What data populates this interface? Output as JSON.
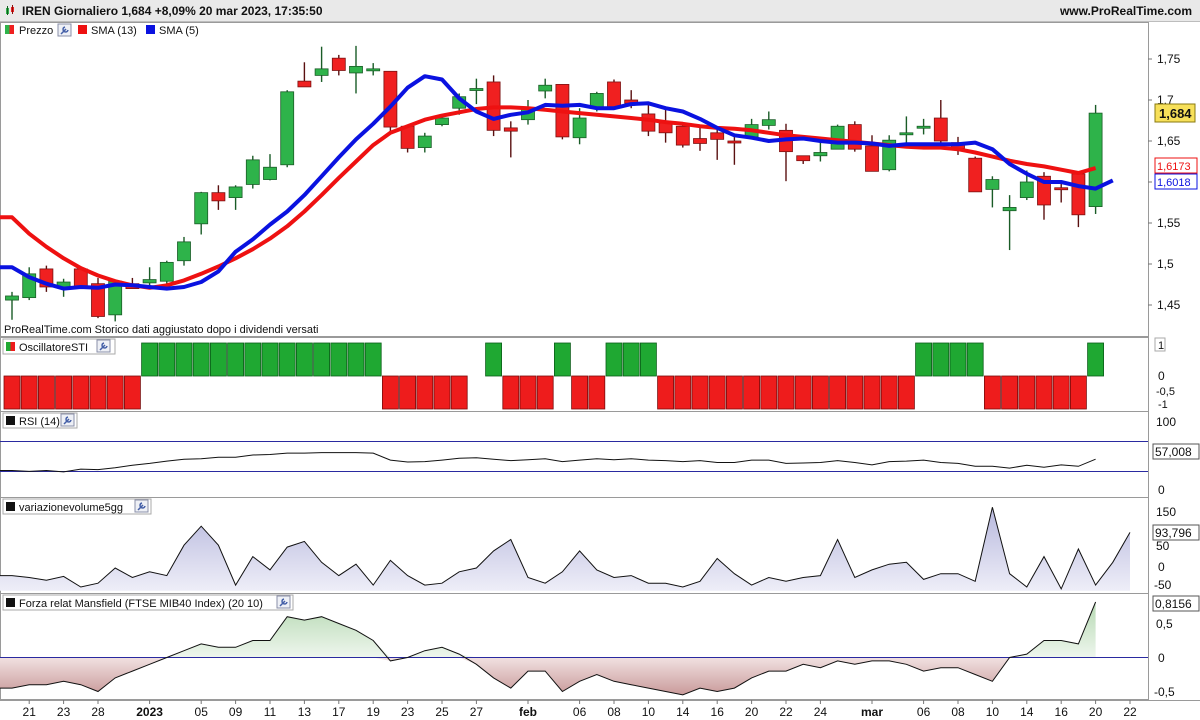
{
  "header": {
    "title": "IREN Giornaliero 1,684 +8,09% 20 mar 2023, 17:35:50",
    "site": "www.ProRealTime.com"
  },
  "colors": {
    "up": "#2eb34a",
    "down": "#f02020",
    "sma13": "#ee1111",
    "sma5": "#0a12e0",
    "osc_up": "#1fa832",
    "osc_down": "#ee1c1c"
  },
  "price_panel": {
    "legend": [
      "Prezzo",
      "SMA (13)",
      "SMA (5)"
    ],
    "footnote": "ProRealTime.com  Storico dati aggiustato dopo i dividendi versati",
    "ticks": [
      "1,75",
      "1,7",
      "1,65",
      "1,6",
      "1,55",
      "1,5",
      "1,45"
    ],
    "tick_values": [
      1.75,
      1.7,
      1.65,
      1.6,
      1.55,
      1.5,
      1.45
    ],
    "last_price": "1,684",
    "sma13_label": "1,6173",
    "sma5_label": "1,6018"
  },
  "osc_panel": {
    "title": "OscillatoreSTI",
    "ticks": [
      "1",
      "0",
      "-0,5",
      "-1"
    ]
  },
  "rsi_panel": {
    "title": "RSI (14)",
    "ticks": [
      "100",
      "0"
    ],
    "value_label": "57,008"
  },
  "vol_panel": {
    "title": "variazionevolume5gg",
    "ticks": [
      "150",
      "100",
      "50",
      "0",
      "-50"
    ],
    "value_label": "93,796"
  },
  "mans_panel": {
    "title": "Forza relat Mansfield (FTSE MIB40 Index) (20 10)",
    "ticks": [
      "0,5",
      "0",
      "-0,5"
    ],
    "value_label": "0,8156"
  },
  "x_labels": [
    {
      "i": 1,
      "t": "21"
    },
    {
      "i": 3,
      "t": "23"
    },
    {
      "i": 5,
      "t": "28"
    },
    {
      "i": 8,
      "t": "2023"
    },
    {
      "i": 11,
      "t": "05"
    },
    {
      "i": 13,
      "t": "09"
    },
    {
      "i": 15,
      "t": "11"
    },
    {
      "i": 17,
      "t": "13"
    },
    {
      "i": 19,
      "t": "17"
    },
    {
      "i": 21,
      "t": "19"
    },
    {
      "i": 23,
      "t": "23"
    },
    {
      "i": 25,
      "t": "25"
    },
    {
      "i": 27,
      "t": "27"
    },
    {
      "i": 30,
      "t": "feb"
    },
    {
      "i": 33,
      "t": "06"
    },
    {
      "i": 35,
      "t": "08"
    },
    {
      "i": 37,
      "t": "10"
    },
    {
      "i": 39,
      "t": "14"
    },
    {
      "i": 41,
      "t": "16"
    },
    {
      "i": 43,
      "t": "20"
    },
    {
      "i": 45,
      "t": "22"
    },
    {
      "i": 47,
      "t": "24"
    },
    {
      "i": 50,
      "t": "mar"
    },
    {
      "i": 53,
      "t": "06"
    },
    {
      "i": 55,
      "t": "08"
    },
    {
      "i": 57,
      "t": "10"
    },
    {
      "i": 59,
      "t": "14"
    },
    {
      "i": 61,
      "t": "16"
    },
    {
      "i": 63,
      "t": "20"
    },
    {
      "i": 65,
      "t": "22"
    }
  ],
  "chart_data": {
    "type": "candlestick",
    "candles": [
      {
        "o": 1.456,
        "h": 1.466,
        "l": 1.432,
        "c": 1.461
      },
      {
        "o": 1.459,
        "h": 1.496,
        "l": 1.456,
        "c": 1.488
      },
      {
        "o": 1.494,
        "h": 1.498,
        "l": 1.466,
        "c": 1.472
      },
      {
        "o": 1.472,
        "h": 1.482,
        "l": 1.46,
        "c": 1.478
      },
      {
        "o": 1.494,
        "h": 1.497,
        "l": 1.471,
        "c": 1.471
      },
      {
        "o": 1.476,
        "h": 1.483,
        "l": 1.434,
        "c": 1.436
      },
      {
        "o": 1.438,
        "h": 1.478,
        "l": 1.43,
        "c": 1.479
      },
      {
        "o": 1.476,
        "h": 1.483,
        "l": 1.47,
        "c": 1.47
      },
      {
        "o": 1.477,
        "h": 1.496,
        "l": 1.473,
        "c": 1.481
      },
      {
        "o": 1.479,
        "h": 1.504,
        "l": 1.471,
        "c": 1.502
      },
      {
        "o": 1.504,
        "h": 1.533,
        "l": 1.498,
        "c": 1.527
      },
      {
        "o": 1.549,
        "h": 1.588,
        "l": 1.536,
        "c": 1.587
      },
      {
        "o": 1.587,
        "h": 1.596,
        "l": 1.566,
        "c": 1.577
      },
      {
        "o": 1.581,
        "h": 1.596,
        "l": 1.566,
        "c": 1.594
      },
      {
        "o": 1.597,
        "h": 1.632,
        "l": 1.592,
        "c": 1.627
      },
      {
        "o": 1.603,
        "h": 1.634,
        "l": 1.602,
        "c": 1.618
      },
      {
        "o": 1.621,
        "h": 1.712,
        "l": 1.618,
        "c": 1.71
      },
      {
        "o": 1.723,
        "h": 1.746,
        "l": 1.716,
        "c": 1.716
      },
      {
        "o": 1.73,
        "h": 1.765,
        "l": 1.722,
        "c": 1.738
      },
      {
        "o": 1.751,
        "h": 1.755,
        "l": 1.73,
        "c": 1.736
      },
      {
        "o": 1.733,
        "h": 1.766,
        "l": 1.708,
        "c": 1.741
      },
      {
        "o": 1.738,
        "h": 1.745,
        "l": 1.73,
        "c": 1.738
      },
      {
        "o": 1.735,
        "h": 1.735,
        "l": 1.66,
        "c": 1.667
      },
      {
        "o": 1.668,
        "h": 1.668,
        "l": 1.636,
        "c": 1.641
      },
      {
        "o": 1.642,
        "h": 1.66,
        "l": 1.636,
        "c": 1.656
      },
      {
        "o": 1.67,
        "h": 1.681,
        "l": 1.668,
        "c": 1.678
      },
      {
        "o": 1.69,
        "h": 1.708,
        "l": 1.682,
        "c": 1.704
      },
      {
        "o": 1.714,
        "h": 1.726,
        "l": 1.695,
        "c": 1.714
      },
      {
        "o": 1.722,
        "h": 1.73,
        "l": 1.656,
        "c": 1.663
      },
      {
        "o": 1.666,
        "h": 1.674,
        "l": 1.63,
        "c": 1.662
      },
      {
        "o": 1.676,
        "h": 1.7,
        "l": 1.67,
        "c": 1.691
      },
      {
        "o": 1.711,
        "h": 1.726,
        "l": 1.702,
        "c": 1.718
      },
      {
        "o": 1.719,
        "h": 1.719,
        "l": 1.652,
        "c": 1.655
      },
      {
        "o": 1.654,
        "h": 1.69,
        "l": 1.646,
        "c": 1.678
      },
      {
        "o": 1.69,
        "h": 1.71,
        "l": 1.686,
        "c": 1.708
      },
      {
        "o": 1.722,
        "h": 1.725,
        "l": 1.69,
        "c": 1.691
      },
      {
        "o": 1.7,
        "h": 1.712,
        "l": 1.69,
        "c": 1.696
      },
      {
        "o": 1.683,
        "h": 1.695,
        "l": 1.656,
        "c": 1.662
      },
      {
        "o": 1.672,
        "h": 1.688,
        "l": 1.648,
        "c": 1.66
      },
      {
        "o": 1.668,
        "h": 1.67,
        "l": 1.642,
        "c": 1.645
      },
      {
        "o": 1.653,
        "h": 1.67,
        "l": 1.638,
        "c": 1.647
      },
      {
        "o": 1.66,
        "h": 1.664,
        "l": 1.627,
        "c": 1.652
      },
      {
        "o": 1.65,
        "h": 1.658,
        "l": 1.621,
        "c": 1.649
      },
      {
        "o": 1.655,
        "h": 1.677,
        "l": 1.654,
        "c": 1.67
      },
      {
        "o": 1.669,
        "h": 1.686,
        "l": 1.664,
        "c": 1.676
      },
      {
        "o": 1.663,
        "h": 1.671,
        "l": 1.601,
        "c": 1.637
      },
      {
        "o": 1.632,
        "h": 1.632,
        "l": 1.622,
        "c": 1.626
      },
      {
        "o": 1.632,
        "h": 1.654,
        "l": 1.625,
        "c": 1.636
      },
      {
        "o": 1.64,
        "h": 1.67,
        "l": 1.64,
        "c": 1.668
      },
      {
        "o": 1.67,
        "h": 1.674,
        "l": 1.637,
        "c": 1.64
      },
      {
        "o": 1.644,
        "h": 1.657,
        "l": 1.614,
        "c": 1.613
      },
      {
        "o": 1.615,
        "h": 1.657,
        "l": 1.613,
        "c": 1.651
      },
      {
        "o": 1.659,
        "h": 1.68,
        "l": 1.648,
        "c": 1.66
      },
      {
        "o": 1.668,
        "h": 1.677,
        "l": 1.658,
        "c": 1.668
      },
      {
        "o": 1.678,
        "h": 1.7,
        "l": 1.64,
        "c": 1.65
      },
      {
        "o": 1.648,
        "h": 1.655,
        "l": 1.633,
        "c": 1.641
      },
      {
        "o": 1.629,
        "h": 1.631,
        "l": 1.595,
        "c": 1.588
      },
      {
        "o": 1.591,
        "h": 1.607,
        "l": 1.569,
        "c": 1.603
      },
      {
        "o": 1.565,
        "h": 1.584,
        "l": 1.517,
        "c": 1.569
      },
      {
        "o": 1.581,
        "h": 1.614,
        "l": 1.578,
        "c": 1.6
      },
      {
        "o": 1.607,
        "h": 1.612,
        "l": 1.554,
        "c": 1.572
      },
      {
        "o": 1.593,
        "h": 1.6,
        "l": 1.575,
        "c": 1.592
      },
      {
        "o": 1.61,
        "h": 1.611,
        "l": 1.545,
        "c": 1.56
      },
      {
        "o": 1.57,
        "h": 1.694,
        "l": 1.561,
        "c": 1.684
      }
    ],
    "sma13": [
      1.557,
      1.537,
      1.521,
      1.507,
      1.495,
      1.486,
      1.479,
      1.474,
      1.471,
      1.474,
      1.48,
      1.488,
      1.497,
      1.507,
      1.518,
      1.531,
      1.546,
      1.564,
      1.584,
      1.605,
      1.625,
      1.645,
      1.66,
      1.668,
      1.676,
      1.681,
      1.685,
      1.689,
      1.691,
      1.691,
      1.69,
      1.688,
      1.686,
      1.684,
      1.682,
      1.68,
      1.678,
      1.676,
      1.673,
      1.671,
      1.668,
      1.666,
      1.665,
      1.663,
      1.66,
      1.657,
      1.655,
      1.653,
      1.651,
      1.649,
      1.647,
      1.645,
      1.643,
      1.642,
      1.642,
      1.64,
      1.636,
      1.631,
      1.626,
      1.622,
      1.619,
      1.615,
      1.611,
      1.617
    ],
    "sma5": [
      1.496,
      1.484,
      1.476,
      1.47,
      1.472,
      1.471,
      1.475,
      1.474,
      1.472,
      1.47,
      1.472,
      1.478,
      1.491,
      1.515,
      1.53,
      1.548,
      1.564,
      1.584,
      1.607,
      1.63,
      1.652,
      1.671,
      1.692,
      1.715,
      1.729,
      1.725,
      1.702,
      1.686,
      1.677,
      1.682,
      1.685,
      1.694,
      1.693,
      1.694,
      1.69,
      1.69,
      1.695,
      1.696,
      1.69,
      1.686,
      1.677,
      1.666,
      1.657,
      1.654,
      1.65,
      1.652,
      1.653,
      1.65,
      1.648,
      1.648,
      1.647,
      1.644,
      1.646,
      1.646,
      1.646,
      1.646,
      1.648,
      1.64,
      1.622,
      1.61,
      1.6,
      1.6,
      1.595,
      1.592,
      1.602
    ],
    "sti": [
      -1,
      -1,
      -1,
      -1,
      -1,
      -1,
      -1,
      -1,
      1,
      1,
      1,
      1,
      1,
      1,
      1,
      1,
      1,
      1,
      1,
      1,
      1,
      1,
      -1,
      -1,
      -1,
      -1,
      -1,
      0,
      1,
      -1,
      -1,
      -1,
      1,
      -1,
      -1,
      1,
      1,
      1,
      -1,
      -1,
      -1,
      -1,
      -1,
      -1,
      -1,
      -1,
      -1,
      -1,
      -1,
      -1,
      -1,
      -1,
      -1,
      1,
      1,
      1,
      1,
      -1,
      -1,
      -1,
      -1,
      -1,
      -1,
      1
    ],
    "rsi": [
      33,
      31,
      33,
      30,
      36,
      35,
      39,
      44,
      48,
      53,
      57,
      58,
      61,
      61,
      66,
      67,
      70,
      70,
      71,
      71,
      71,
      70,
      55,
      51,
      52,
      55,
      59,
      60,
      57,
      54,
      56,
      58,
      52,
      55,
      58,
      56,
      58,
      55,
      54,
      52,
      54,
      50,
      50,
      55,
      55,
      48,
      49,
      50,
      54,
      50,
      45,
      52,
      53,
      55,
      50,
      48,
      42,
      42,
      38,
      44,
      40,
      45,
      42,
      57
    ],
    "vol": [
      -20,
      -25,
      -32,
      -22,
      -50,
      -40,
      0,
      -25,
      -10,
      -20,
      60,
      110,
      60,
      -45,
      30,
      -5,
      55,
      70,
      15,
      -20,
      10,
      -45,
      20,
      -20,
      -45,
      -40,
      -10,
      0,
      45,
      75,
      -25,
      -40,
      -10,
      45,
      -5,
      -25,
      -20,
      -40,
      -40,
      -50,
      -35,
      25,
      -15,
      -45,
      -25,
      -35,
      -25,
      -20,
      75,
      -25,
      -5,
      10,
      15,
      -30,
      -15,
      -15,
      -35,
      160,
      -15,
      -50,
      30,
      -55,
      50,
      -45,
      15,
      93.8
    ],
    "mansfield": [
      -0.45,
      -0.4,
      -0.4,
      -0.35,
      -0.4,
      -0.5,
      -0.3,
      -0.2,
      -0.1,
      0,
      0.1,
      0.2,
      0.15,
      0.15,
      0.25,
      0.25,
      0.6,
      0.55,
      0.6,
      0.5,
      0.4,
      0.25,
      -0.05,
      0,
      0.1,
      0.15,
      0.05,
      -0.1,
      -0.3,
      -0.45,
      -0.2,
      -0.2,
      -0.5,
      -0.35,
      -0.25,
      -0.35,
      -0.4,
      -0.45,
      -0.5,
      -0.55,
      -0.45,
      -0.5,
      -0.45,
      -0.3,
      -0.2,
      -0.2,
      -0.1,
      -0.15,
      -0.05,
      -0.1,
      -0.05,
      -0.05,
      -0.1,
      -0.2,
      -0.15,
      -0.15,
      -0.25,
      -0.35,
      0.0,
      0.05,
      0.25,
      0.25,
      0.2,
      0.8156
    ]
  }
}
